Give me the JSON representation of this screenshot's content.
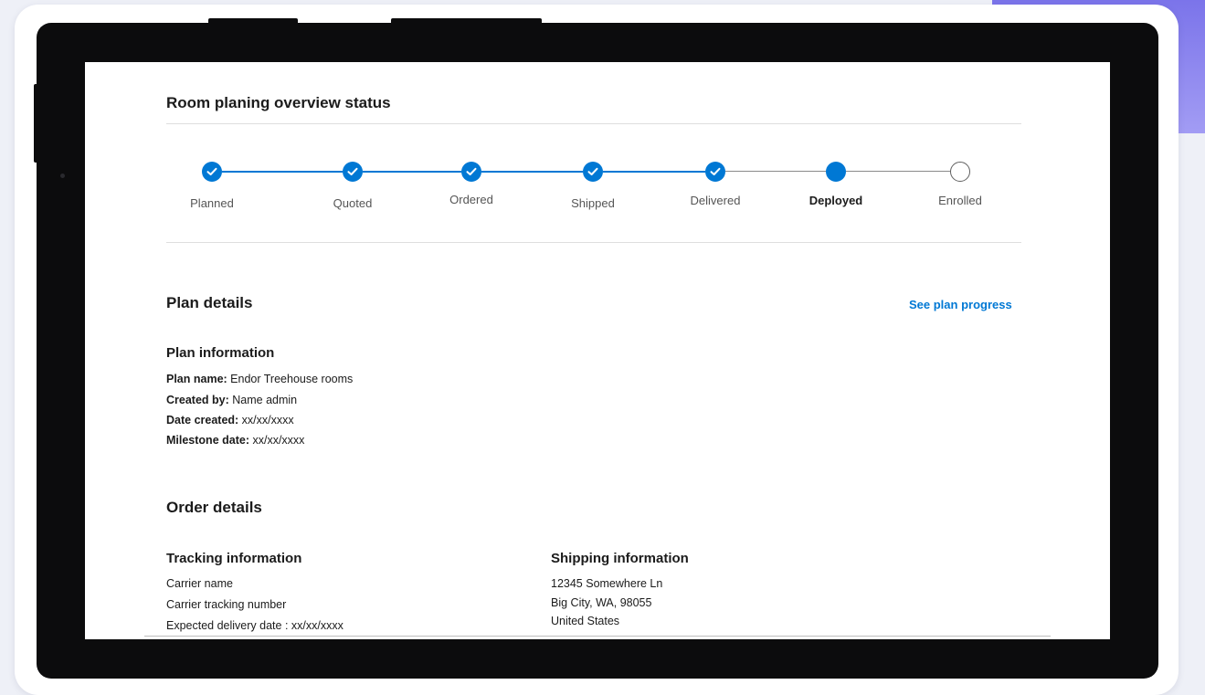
{
  "overview": {
    "title": "Room planing overview status",
    "steps": [
      {
        "label": "Planned",
        "state": "done"
      },
      {
        "label": "Quoted",
        "state": "done"
      },
      {
        "label": "Ordered",
        "state": "done"
      },
      {
        "label": "Shipped",
        "state": "done"
      },
      {
        "label": "Delivered",
        "state": "done"
      },
      {
        "label": "Deployed",
        "state": "current"
      },
      {
        "label": "Enrolled",
        "state": "todo"
      }
    ]
  },
  "plan": {
    "title": "Plan details",
    "link_label": "See plan progress",
    "info_title": "Plan information",
    "fields": [
      {
        "label": "Plan name:",
        "value": " Endor Treehouse rooms"
      },
      {
        "label": "Created by:",
        "value": " Name admin"
      },
      {
        "label": "Date created:",
        "value": " xx/xx/xxxx"
      },
      {
        "label": "Milestone date:",
        "value": " xx/xx/xxxx"
      }
    ]
  },
  "order": {
    "title": "Order details",
    "tracking": {
      "title": "Tracking information",
      "lines": [
        "Carrier name",
        "Carrier tracking number",
        "Expected delivery date : xx/xx/xxxx"
      ]
    },
    "shipping": {
      "title": "Shipping information",
      "lines": [
        "12345 Somewhere Ln",
        "Big City, WA, 98055",
        "United States"
      ]
    }
  },
  "colors": {
    "accent": "#0078d4",
    "line_done": "#0078d4",
    "line_todo": "#8a8a8a",
    "purple": "#8b84ef"
  },
  "icons": {
    "step_done": "checkmark-circle-icon",
    "step_current": "filled-circle-icon",
    "step_todo": "empty-circle-icon"
  }
}
